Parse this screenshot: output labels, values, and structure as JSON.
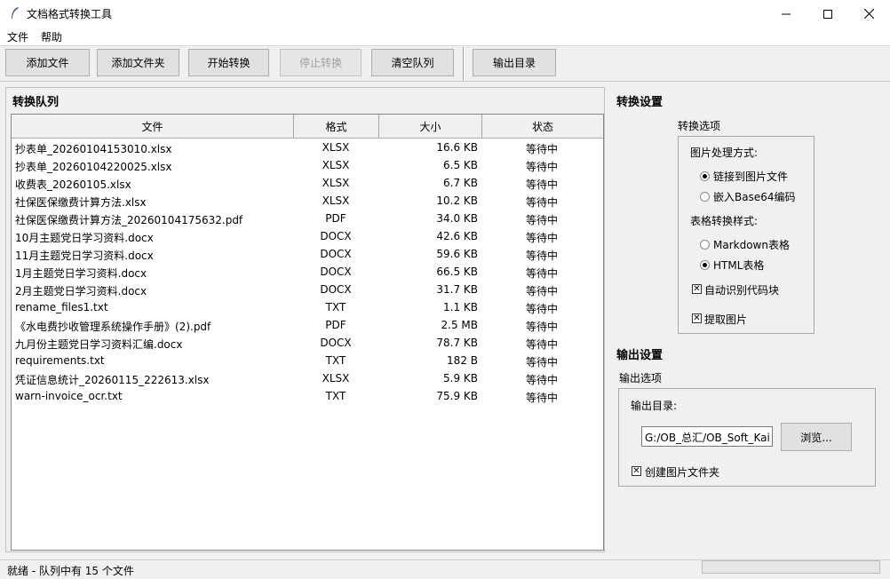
{
  "window": {
    "title": "文档格式转换工具",
    "minimize_symbol": "—",
    "maximize_symbol": "☐",
    "close_symbol": "✕"
  },
  "menu": {
    "items": [
      "文件",
      "帮助"
    ]
  },
  "toolbar": {
    "add_file": "添加文件",
    "add_folder": "添加文件夹",
    "start": "开始转换",
    "stop": "停止转换",
    "clear": "清空队列",
    "output_dir": "输出目录"
  },
  "queue": {
    "title": "转换队列",
    "columns": [
      "文件",
      "格式",
      "大小",
      "状态"
    ],
    "rows": [
      {
        "name": "抄表单_20260104153010.xlsx",
        "format": "XLSX",
        "size": "16.6 KB",
        "status": "等待中"
      },
      {
        "name": "抄表单_20260104220025.xlsx",
        "format": "XLSX",
        "size": "6.5 KB",
        "status": "等待中"
      },
      {
        "name": "收费表_20260105.xlsx",
        "format": "XLSX",
        "size": "6.7 KB",
        "status": "等待中"
      },
      {
        "name": "社保医保缴费计算方法.xlsx",
        "format": "XLSX",
        "size": "10.2 KB",
        "status": "等待中"
      },
      {
        "name": "社保医保缴费计算方法_20260104175632.pdf",
        "format": "PDF",
        "size": "34.0 KB",
        "status": "等待中"
      },
      {
        "name": "10月主题党日学习资料.docx",
        "format": "DOCX",
        "size": "42.6 KB",
        "status": "等待中"
      },
      {
        "name": "11月主题党日学习资料.docx",
        "format": "DOCX",
        "size": "59.6 KB",
        "status": "等待中"
      },
      {
        "name": "1月主题党日学习资料.docx",
        "format": "DOCX",
        "size": "66.5 KB",
        "status": "等待中"
      },
      {
        "name": "2月主题党日学习资料.docx",
        "format": "DOCX",
        "size": "31.7 KB",
        "status": "等待中"
      },
      {
        "name": "rename_files1.txt",
        "format": "TXT",
        "size": "1.1 KB",
        "status": "等待中"
      },
      {
        "name": "《水电费抄收管理系统操作手册》(2).pdf",
        "format": "PDF",
        "size": "2.5 MB",
        "status": "等待中"
      },
      {
        "name": "九月份主题党日学习资料汇编.docx",
        "format": "DOCX",
        "size": "78.7 KB",
        "status": "等待中"
      },
      {
        "name": "requirements.txt",
        "format": "TXT",
        "size": "182 B",
        "status": "等待中"
      },
      {
        "name": "凭证信息统计_20260115_222613.xlsx",
        "format": "XLSX",
        "size": "5.9 KB",
        "status": "等待中"
      },
      {
        "name": "warn-invoice_ocr.txt",
        "format": "TXT",
        "size": "75.9 KB",
        "status": "等待中"
      }
    ]
  },
  "settings": {
    "title": "转换设置",
    "group_label": "转换选项",
    "image_mode_label": "图片处理方式:",
    "image_link": "链接到图片文件",
    "image_base64": "嵌入Base64编码",
    "table_style_label": "表格转换样式:",
    "table_markdown": "Markdown表格",
    "table_html": "HTML表格",
    "auto_code": "自动识别代码块",
    "extract_images": "提取图片",
    "image_mode_selected": "link",
    "table_style_selected": "html",
    "auto_code_checked": true,
    "extract_images_checked": true
  },
  "output": {
    "title": "输出设置",
    "group_label": "输出选项",
    "dir_label": "输出目录:",
    "dir_value": "G:/OB_总汇/OB_Soft_Kai",
    "browse": "浏览...",
    "create_image_folder": "创建图片文件夹",
    "create_image_folder_checked": true,
    "check_mark": "✕"
  },
  "status": {
    "text": "就绪 - 队列中有 15 个文件",
    "progress": 0
  }
}
